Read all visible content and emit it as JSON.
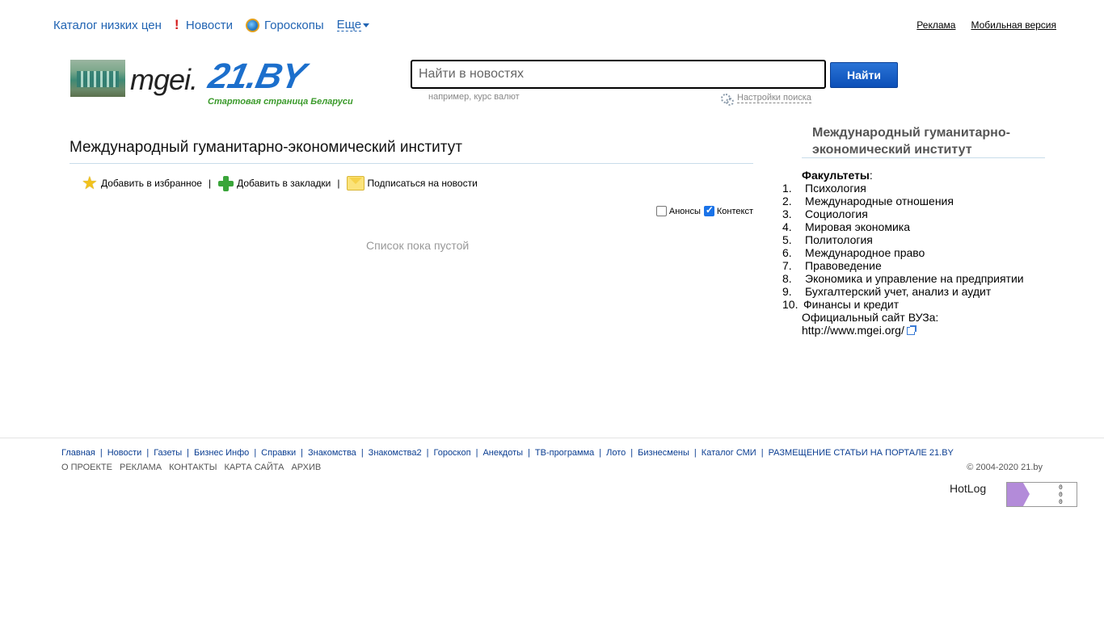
{
  "topnav": {
    "items": [
      {
        "label": "Каталог низких цен"
      },
      {
        "label": "Новости",
        "icon": "exclamation-icon"
      },
      {
        "label": "Гороскопы",
        "icon": "zodiac-globe-icon"
      }
    ],
    "more_label": "Еще"
  },
  "toplinks": {
    "ads": "Реклама",
    "mobile": "Мобильная версия"
  },
  "logo": {
    "site_text": "mgei.",
    "brand_text": "21.BY",
    "tagline": "Стартовая страница Беларуси"
  },
  "search": {
    "placeholder": "Найти в новостях",
    "button": "Найти",
    "hint": "например, курс валют",
    "settings": "Настройки поиска"
  },
  "main": {
    "title": "Международный гуманитарно-экономический институт",
    "actions": {
      "favorites": "Добавить в избранное",
      "bookmarks": "Добавить в закладки",
      "subscribe": "Подписаться на новости",
      "separator": "|"
    },
    "filters": {
      "announcements": {
        "label": "Анонсы",
        "checked": false
      },
      "context": {
        "label": "Контекст",
        "checked": true
      }
    },
    "empty_text": "Список пока пустой"
  },
  "sidebar": {
    "title": "Международный гуманитарно-экономический институт",
    "faculties_label": "Факультеты",
    "faculties_colon": ":",
    "faculties": [
      {
        "n": "1.",
        "name": "Психология"
      },
      {
        "n": "2.",
        "name": "Международные отношения"
      },
      {
        "n": "3.",
        "name": "Социология"
      },
      {
        "n": "4.",
        "name": "Мировая экономика"
      },
      {
        "n": "5.",
        "name": "Политология"
      },
      {
        "n": "6.",
        "name": "Международное право"
      },
      {
        "n": "7.",
        "name": "Правоведение"
      },
      {
        "n": "8.",
        "name": "Экономика и управление на предприятии"
      },
      {
        "n": "9.",
        "name": "Бухгалтерский учет, анализ и аудит"
      },
      {
        "n": "10.",
        "name": "Финансы и кредит"
      }
    ],
    "official_label": "Официальный сайт ВУЗа:",
    "official_url": "http://www.mgei.org/"
  },
  "footer": {
    "links": [
      "Главная",
      "Новости",
      "Газеты",
      "Бизнес Инфо",
      "Справки",
      "Знакомства",
      "Знакомства2",
      "Гороскоп",
      "Анекдоты",
      "ТВ-программа",
      "Лото",
      "Бизнесмены",
      "Каталог СМИ",
      "РАЗМЕЩЕНИЕ СТАТЬИ НА ПОРТАЛЕ 21.BY"
    ],
    "separator": "|",
    "links2": [
      "О ПРОЕКТЕ",
      "РЕКЛАМА",
      "КОНТАКТЫ",
      "КАРТА САЙТА",
      "АРХИВ"
    ],
    "copyright": "© 2004-2020 21.by",
    "hotlog_alt": "HotLog",
    "counter_rows": [
      "0",
      "0",
      "0"
    ]
  }
}
